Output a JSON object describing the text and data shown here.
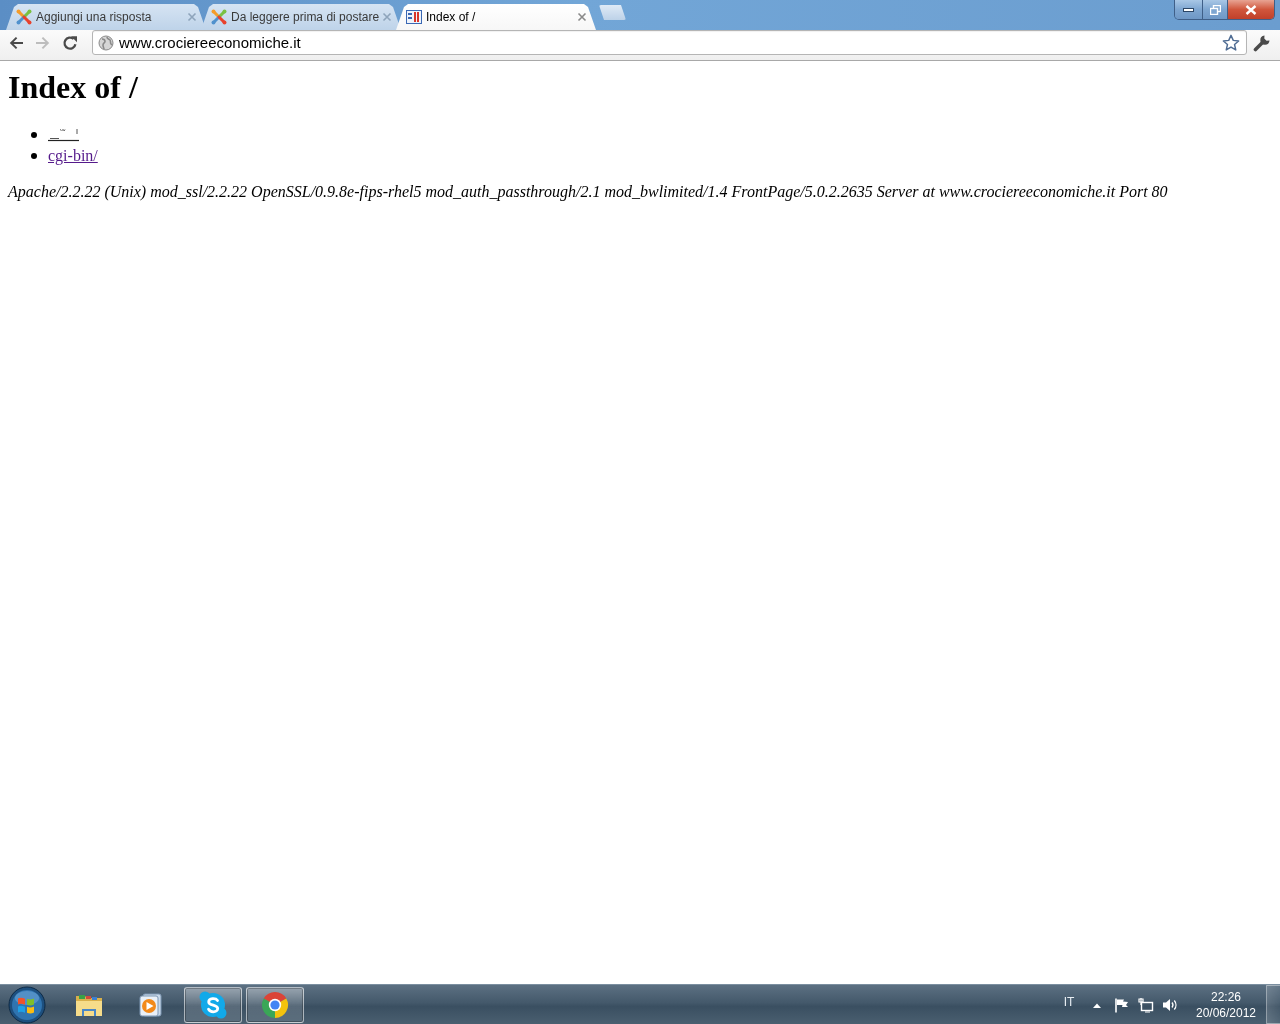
{
  "browser": {
    "tabs": [
      {
        "kind": "knot",
        "title": "Aggiungi una risposta",
        "selected": false
      },
      {
        "kind": "knot",
        "title": "Da leggere prima di postare",
        "selected": false
      },
      {
        "kind": "grid",
        "title": "Index of /",
        "selected": true
      }
    ],
    "nav": [
      {
        "kind": "back",
        "disabled": false
      },
      {
        "kind": "forward",
        "disabled": true
      },
      {
        "kind": "reload",
        "disabled": false
      }
    ],
    "address_bar": {
      "value": "www.crociereeconomiche.it"
    }
  },
  "page": {
    "heading": "Index of /",
    "entries": [
      {
        "kind": "obscured"
      },
      {
        "kind": "link",
        "text": "cgi-bin/",
        "visited": true
      }
    ],
    "footer": "Apache/2.2.22 (Unix) mod_ssl/2.2.22 OpenSSL/0.9.8e-fips-rhel5 mod_auth_passthrough/2.1 mod_bwlimited/1.4 FrontPage/5.0.2.2635 Server at www.crociereeconomiche.it Port 80"
  },
  "taskbar": {
    "apps": [
      {
        "kind": "folder",
        "running": false
      },
      {
        "kind": "media",
        "running": false
      },
      {
        "kind": "skype",
        "running": true
      },
      {
        "kind": "chrome",
        "running": true
      }
    ],
    "language": "IT",
    "clock": {
      "time": "22:26",
      "date": "20/06/2012"
    }
  }
}
